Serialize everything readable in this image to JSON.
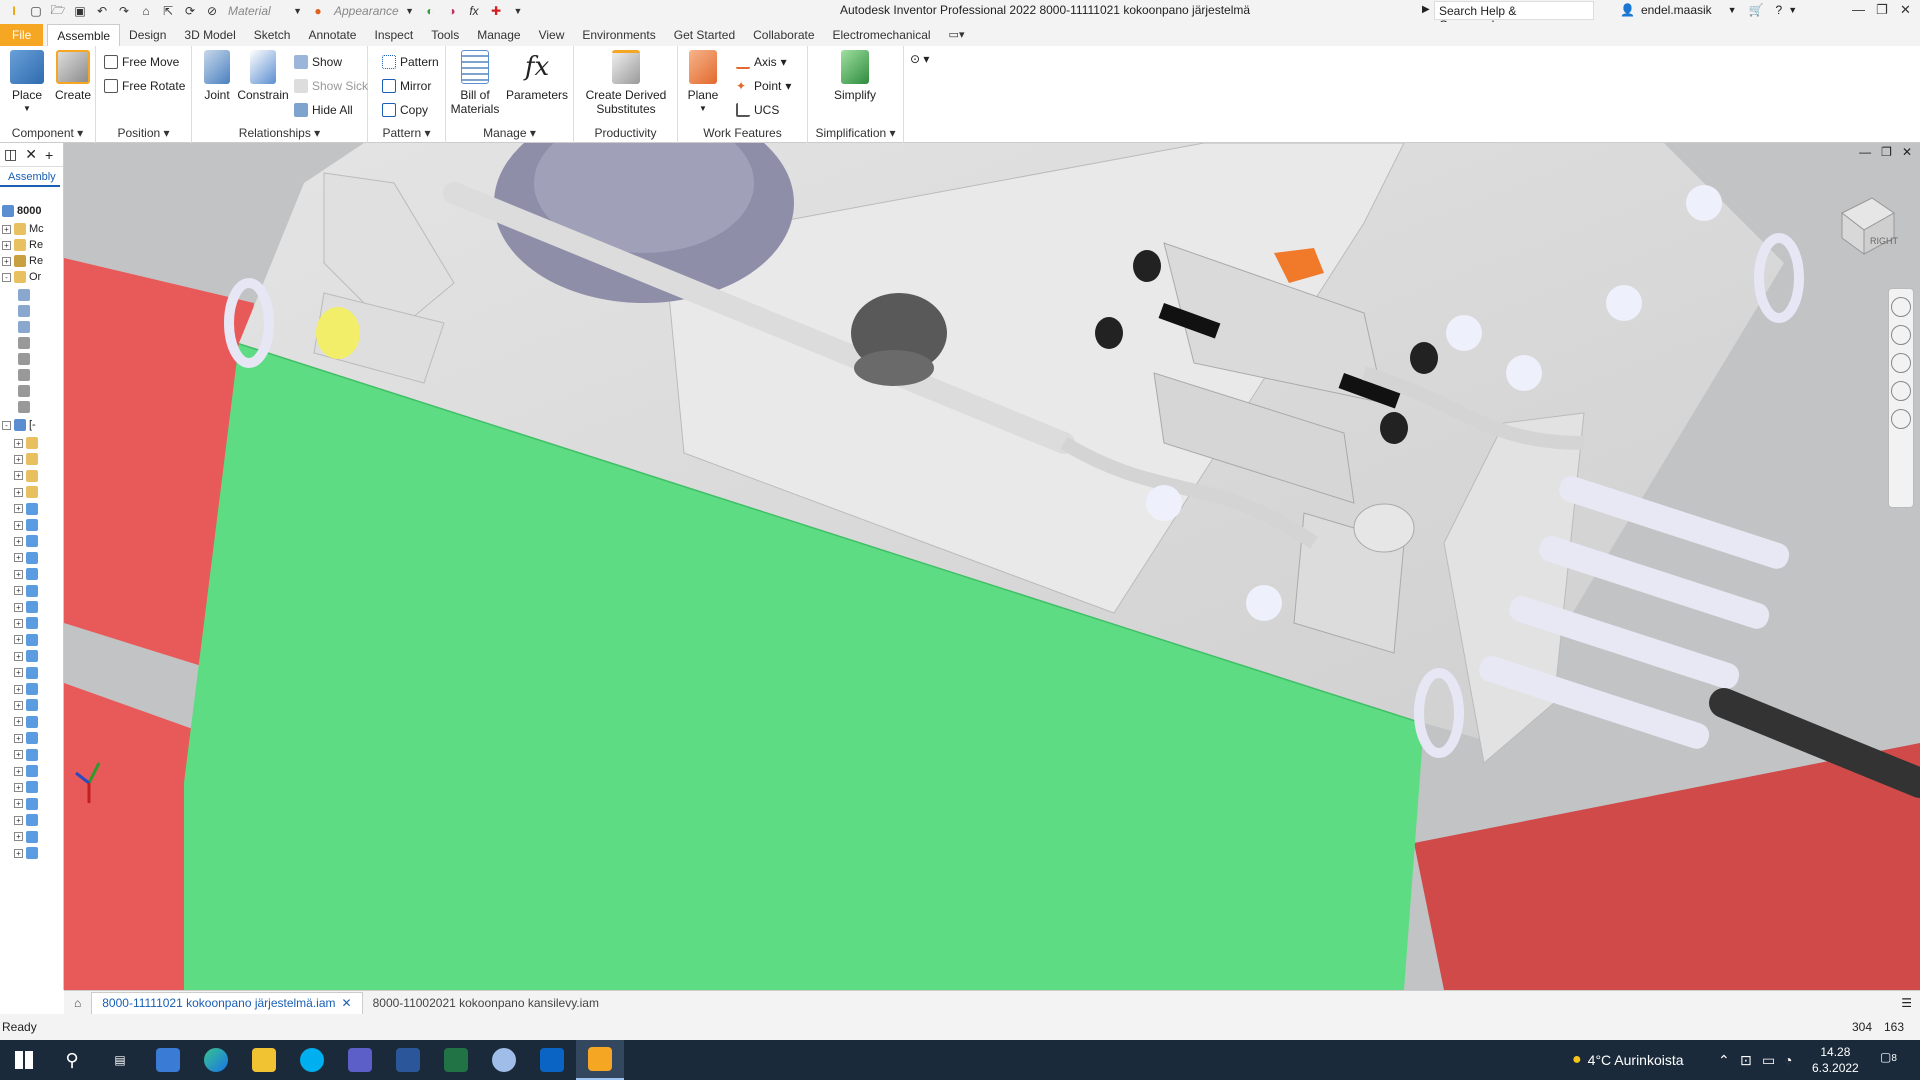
{
  "titlebar": {
    "app_title": "Autodesk Inventor Professional 2022   8000-11111021 kokoonpano järjestelmä",
    "material_placeholder": "Material",
    "appearance_placeholder": "Appearance",
    "help_search": "Search Help & Commands...",
    "user_name": "endel.maasik"
  },
  "tabs": [
    "File",
    "Assemble",
    "Design",
    "3D Model",
    "Sketch",
    "Annotate",
    "Inspect",
    "Tools",
    "Manage",
    "View",
    "Environments",
    "Get Started",
    "Collaborate",
    "Electromechanical"
  ],
  "active_tab": "Assemble",
  "ribbon": {
    "component": {
      "title": "Component",
      "place": "Place",
      "create": "Create"
    },
    "position": {
      "title": "Position",
      "free_move": "Free Move",
      "free_rotate": "Free Rotate"
    },
    "relationships": {
      "title": "Relationships",
      "joint": "Joint",
      "constrain": "Constrain",
      "show": "Show",
      "show_sick": "Show Sick",
      "hide_all": "Hide All"
    },
    "pattern": {
      "title": "Pattern",
      "pattern": "Pattern",
      "mirror": "Mirror",
      "copy": "Copy"
    },
    "manage": {
      "title": "Manage",
      "bom_line1": "Bill of",
      "bom_line2": "Materials",
      "parameters": "Parameters"
    },
    "productivity": {
      "title": "Productivity",
      "line1": "Create Derived",
      "line2": "Substitutes"
    },
    "work_features": {
      "title": "Work Features",
      "plane": "Plane",
      "axis": "Axis",
      "point": "Point",
      "ucs": "UCS"
    },
    "simplification": {
      "title": "Simplification",
      "simplify": "Simplify"
    }
  },
  "browser": {
    "tab": "Assembly",
    "root": "8000",
    "rows": [
      {
        "label": "Mc",
        "expand": "+"
      },
      {
        "label": "Re",
        "expand": "+"
      },
      {
        "label": "Re",
        "expand": "+"
      },
      {
        "label": "Or",
        "expand": "-"
      },
      {
        "label": "[-",
        "expand": "-"
      }
    ]
  },
  "doc_tabs": [
    "8000-11111021 kokoonpano järjestelmä.iam",
    "8000-11002021 kokoonpano kansilevy.iam"
  ],
  "status": {
    "text": "Ready",
    "n1": "304",
    "n2": "163"
  },
  "taskbar": {
    "weather": "4°C  Aurinkoista",
    "time": "14.28",
    "date": "6.3.2022",
    "notifications": "8"
  },
  "viewcube_label": "RIGHT"
}
